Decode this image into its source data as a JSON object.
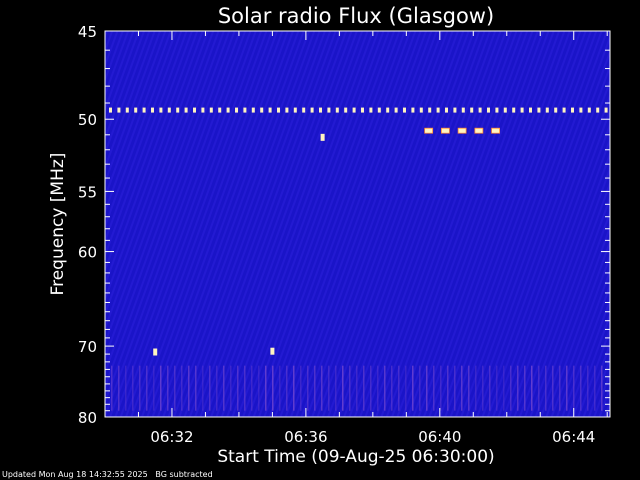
{
  "chart_data": {
    "type": "heatmap",
    "title": "Solar radio Flux (Glasgow)",
    "xlabel": "Start Time (09-Aug-25 06:30:00)",
    "ylabel": "Frequency [MHz]",
    "x_start": "06:30:00",
    "x_end": "06:45:05",
    "y_range": [
      45,
      80
    ],
    "y_scale": "reciprocal",
    "x_ticks": [
      "06:32",
      "06:36",
      "06:40",
      "06:44"
    ],
    "y_ticks": [
      45,
      50,
      55,
      60,
      70,
      80
    ],
    "y_tick_labels": [
      "45",
      "50",
      "55",
      "60",
      "70",
      "80"
    ],
    "colors": {
      "background": "#1a14c8",
      "hot": "#fff4c0",
      "warm": "#ff8a30",
      "axis": "#ffffff"
    },
    "features": [
      {
        "kind": "periodic-interference-line",
        "freq": 49.4
      },
      {
        "kind": "vertical-stripe-band",
        "freq_range": [
          72.5,
          79
        ]
      },
      {
        "kind": "burst",
        "time": "06:35:00",
        "freq": 70.7
      },
      {
        "kind": "burst",
        "time": "06:36:30",
        "freq": 51.2
      },
      {
        "kind": "burst",
        "time": "06:31:30",
        "freq": 70.8
      },
      {
        "kind": "burst-group",
        "times": [
          "06:39:40",
          "06:40:10",
          "06:40:40",
          "06:41:10",
          "06:41:40"
        ],
        "freq": 50.7
      }
    ]
  },
  "footer": {
    "updated": "Updated Mon Aug 18 14:32:55 2025",
    "note": "BG subtracted"
  }
}
